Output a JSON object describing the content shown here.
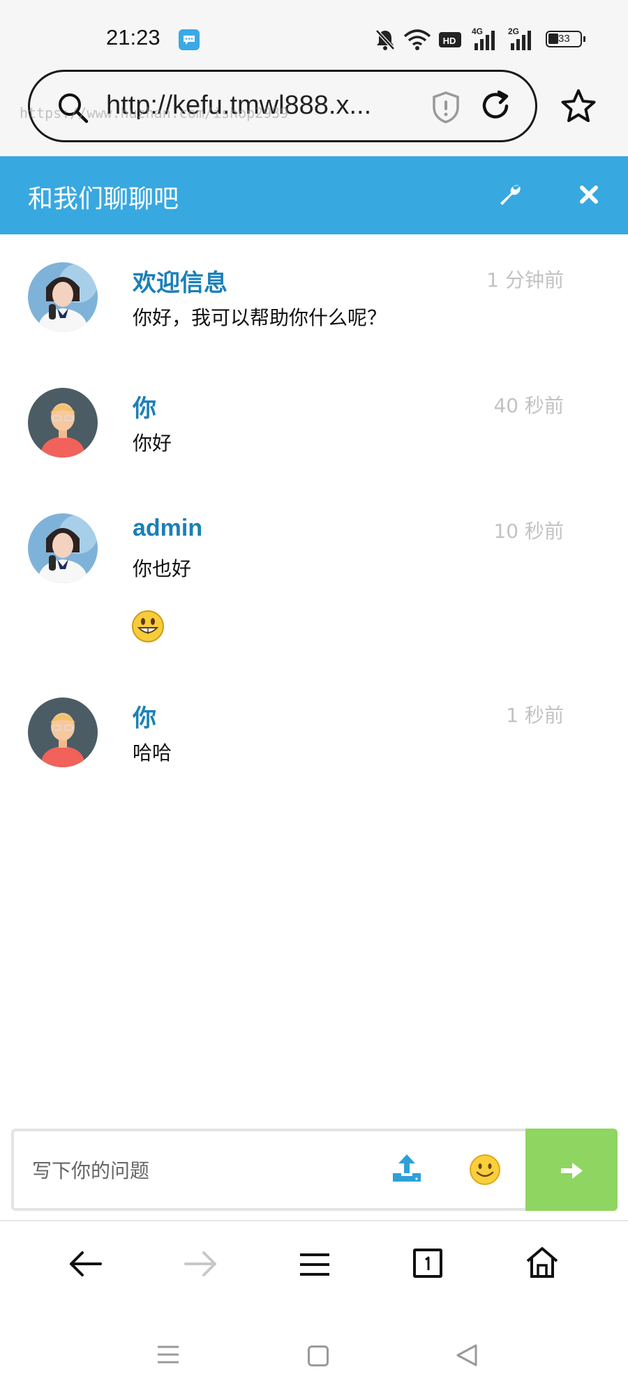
{
  "status_bar": {
    "time": "21:23",
    "network_left": "4G",
    "network_right": "2G",
    "battery": "33"
  },
  "browser": {
    "url": "http://kefu.tmwl888.x...",
    "watermark": "https://www.huzhan.com/ishop2939"
  },
  "chat": {
    "title": "和我们聊聊吧"
  },
  "messages": [
    {
      "author": "欢迎信息",
      "time": "1 分钟前",
      "text": "你好，我可以帮助你什么呢？",
      "avatar": "agent-avatar"
    },
    {
      "author": "你",
      "time": "40 秒前",
      "text": "你好",
      "avatar": "user-avatar"
    },
    {
      "author": "admin",
      "time": "10 秒前",
      "text": "你也好",
      "avatar": "agent-avatar",
      "emoji": "grin-emoticon"
    },
    {
      "author": "你",
      "time": "1 秒前",
      "text": "哈哈",
      "avatar": "user-avatar"
    }
  ],
  "composer": {
    "placeholder": "写下你的问题"
  },
  "colors": {
    "header": "#38a8e1",
    "author": "#1b7fb8",
    "send": "#8fd561",
    "upload_icon": "#2f9fd8"
  }
}
